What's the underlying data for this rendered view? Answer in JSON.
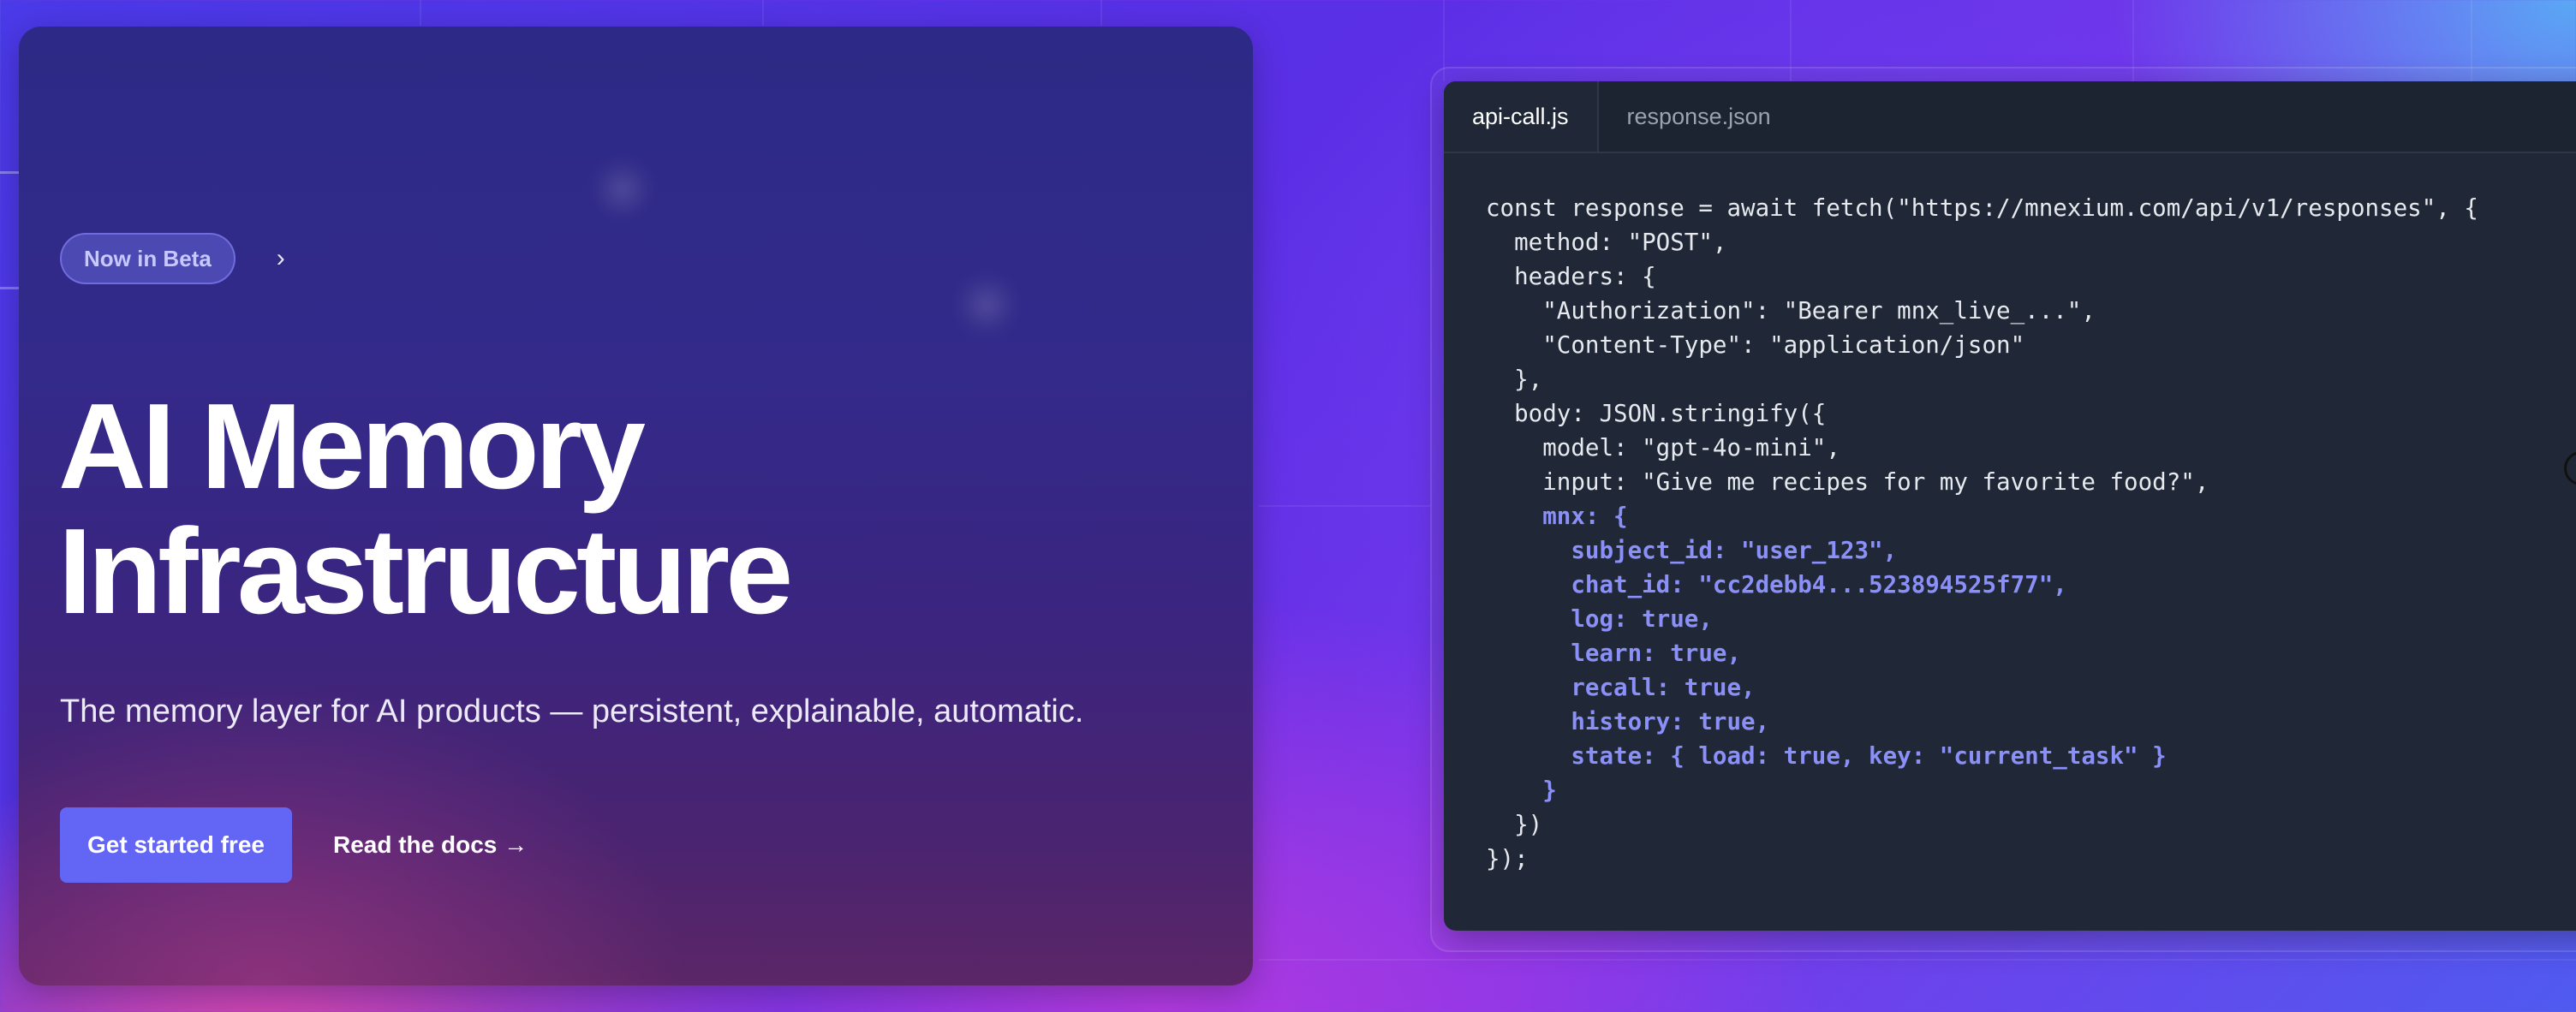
{
  "hero": {
    "badge_label": "Now in Beta",
    "badge_chevron": "›",
    "headline_line1": "AI Memory",
    "headline_line2": "Infrastructure",
    "subtitle": "The memory layer for AI products — persistent, explainable, automatic.",
    "primary_cta": "Get started free",
    "secondary_cta": "Read the docs →"
  },
  "code_panel": {
    "tabs": [
      {
        "label": "api-call.js",
        "active": true
      },
      {
        "label": "response.json",
        "active": false
      }
    ],
    "lines": [
      "const response = await fetch(\"https://mnexium.com/api/v1/responses\", {",
      "  method: \"POST\",",
      "  headers: {",
      "    \"Authorization\": \"Bearer mnx_live_...\",",
      "    \"Content-Type\": \"application/json\"",
      "  },",
      "  body: JSON.stringify({",
      "    model: \"gpt-4o-mini\",",
      "    input: \"Give me recipes for my favorite food?\",",
      "    mnx: {",
      "      subject_id: \"user_123\",",
      "      chat_id: \"cc2debb4...523894525f77\",",
      "      log: true,",
      "      learn: true,",
      "      recall: true,",
      "      history: true,",
      "      state: { load: true, key: \"current_task\" }",
      "    }",
      "  })",
      "});"
    ]
  },
  "colors": {
    "accent": "#6366f5",
    "code_highlight": "#8b8ff8",
    "code_background": "#202837"
  },
  "icons": {
    "badge_chevron": "chevron-right-icon"
  }
}
